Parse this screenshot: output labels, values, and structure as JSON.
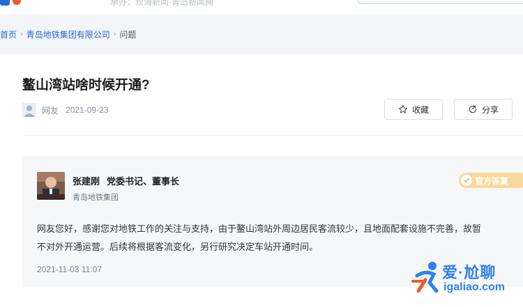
{
  "header": {
    "sub_nav": "承办：观海新闻·青岛新闻网"
  },
  "breadcrumb": {
    "home": "首页",
    "org": "青岛地铁集团有限公司",
    "current": "问题"
  },
  "question": {
    "title": "鳌山湾站啥时候开通?",
    "asker": "网友",
    "date": "2021-09-23"
  },
  "actions": {
    "favorite_label": "收藏",
    "share_label": "分享"
  },
  "answer": {
    "official_name": "张建刚",
    "official_role": "党委书记、董事长",
    "official_org": "青岛地铁集团",
    "badge_label": "官方答复",
    "body": "网友您好，感谢您对地铁工作的关注与支持，由于鳌山湾站外周边居民客流较少，且地面配套设施不完善，故暂不对外开通运营。后续将根据客流变化，另行研究决定车站开通时间。",
    "date": "2021-11-03 11:07"
  },
  "watermark": {
    "brand": "爱·尬聊",
    "domain": "igaliao.com"
  },
  "colors": {
    "link": "#2a6ad6",
    "badge": "#f7d99a",
    "watermark": "#2f7ff0"
  }
}
